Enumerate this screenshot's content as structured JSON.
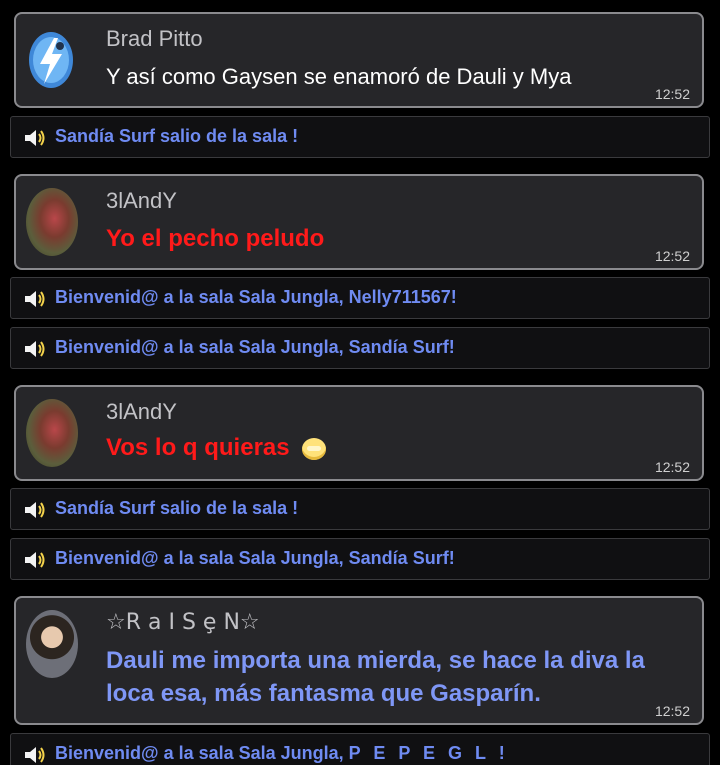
{
  "messages": [
    {
      "username": "Brad Pitto",
      "text": "Y así como Gaysen se enamoró de Dauli y Mya",
      "time": "12:52",
      "avatar": "lightning-bot-avatar"
    },
    {
      "username": "3lAndY",
      "text": "Yo el pecho peludo",
      "time": "12:52",
      "avatar": "painting-photo-avatar"
    },
    {
      "username": "3lAndY",
      "text": "Vos lo q quieras",
      "time": "12:52",
      "avatar": "painting-photo-avatar",
      "emoji": "smiling-emoji"
    },
    {
      "username": "☆R a I S ȩ N☆",
      "text": "Dauli me importa una mierda, se hace la diva la loca esa, más fantasma que Gasparín.",
      "time": "12:52",
      "avatar": "portrait-photo-avatar"
    }
  ],
  "system_notices": [
    {
      "text": "Sandía Surf salio de la sala !",
      "icon": "speaker-icon"
    },
    {
      "text": "Bienvenid@ a la sala Sala Jungla, Nelly711567!",
      "icon": "speaker-icon"
    },
    {
      "text": "Bienvenid@ a la sala Sala Jungla, Sandía Surf!",
      "icon": "speaker-icon"
    },
    {
      "text": "Sandía Surf salio de la sala !",
      "icon": "speaker-icon"
    },
    {
      "text": "Bienvenid@ a la sala Sala Jungla, Sandía Surf!",
      "icon": "speaker-icon"
    },
    {
      "text": "Bienvenid@ a la sala Sala Jungla, ",
      "name": "P E P E G L !",
      "icon": "speaker-icon"
    }
  ],
  "colors": {
    "card_background": "#262629",
    "card_border": "#8a8a8e",
    "notice_text": "#6f8bf2",
    "red_text": "#ff1a1a",
    "blue_text": "#7f97f6"
  }
}
